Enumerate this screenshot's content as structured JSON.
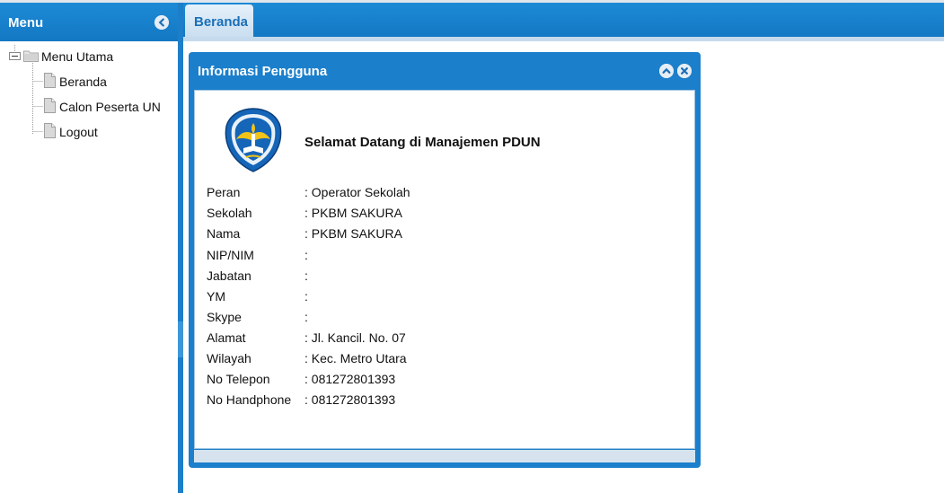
{
  "sidebar": {
    "title": "Menu",
    "tree": {
      "root_label": "Menu Utama",
      "items": [
        {
          "label": "Beranda"
        },
        {
          "label": "Calon Peserta UN"
        },
        {
          "label": "Logout"
        }
      ]
    }
  },
  "tabs": [
    {
      "label": "Beranda"
    }
  ],
  "dialog": {
    "title": "Informasi Pengguna",
    "welcome": "Selamat Datang di Manajemen PDUN",
    "fields": [
      {
        "label": "Peran",
        "value": ": Operator Sekolah"
      },
      {
        "label": "Sekolah",
        "value": ": PKBM SAKURA"
      },
      {
        "label": "Nama",
        "value": ": PKBM SAKURA"
      },
      {
        "label": "NIP/NIM",
        "value": ":"
      },
      {
        "label": "Jabatan",
        "value": ":"
      },
      {
        "label": "YM",
        "value": ":"
      },
      {
        "label": "Skype",
        "value": ":"
      },
      {
        "label": "Alamat",
        "value": ": Jl. Kancil. No. 07"
      },
      {
        "label": "Wilayah",
        "value": ": Kec. Metro Utara"
      },
      {
        "label": "No Telepon",
        "value": ": 081272801393"
      },
      {
        "label": "No Handphone",
        "value": ": 081272801393"
      }
    ]
  },
  "colors": {
    "header_blue": "#1b7fcb",
    "tab_text": "#1a6fb8",
    "logo_blue": "#1565b8",
    "logo_yellow": "#f2c318"
  },
  "icons": [
    "collapse-left-icon",
    "folder-icon",
    "file-icon",
    "collapse-up-icon",
    "close-icon",
    "tut-wuri-handayani-logo"
  ]
}
